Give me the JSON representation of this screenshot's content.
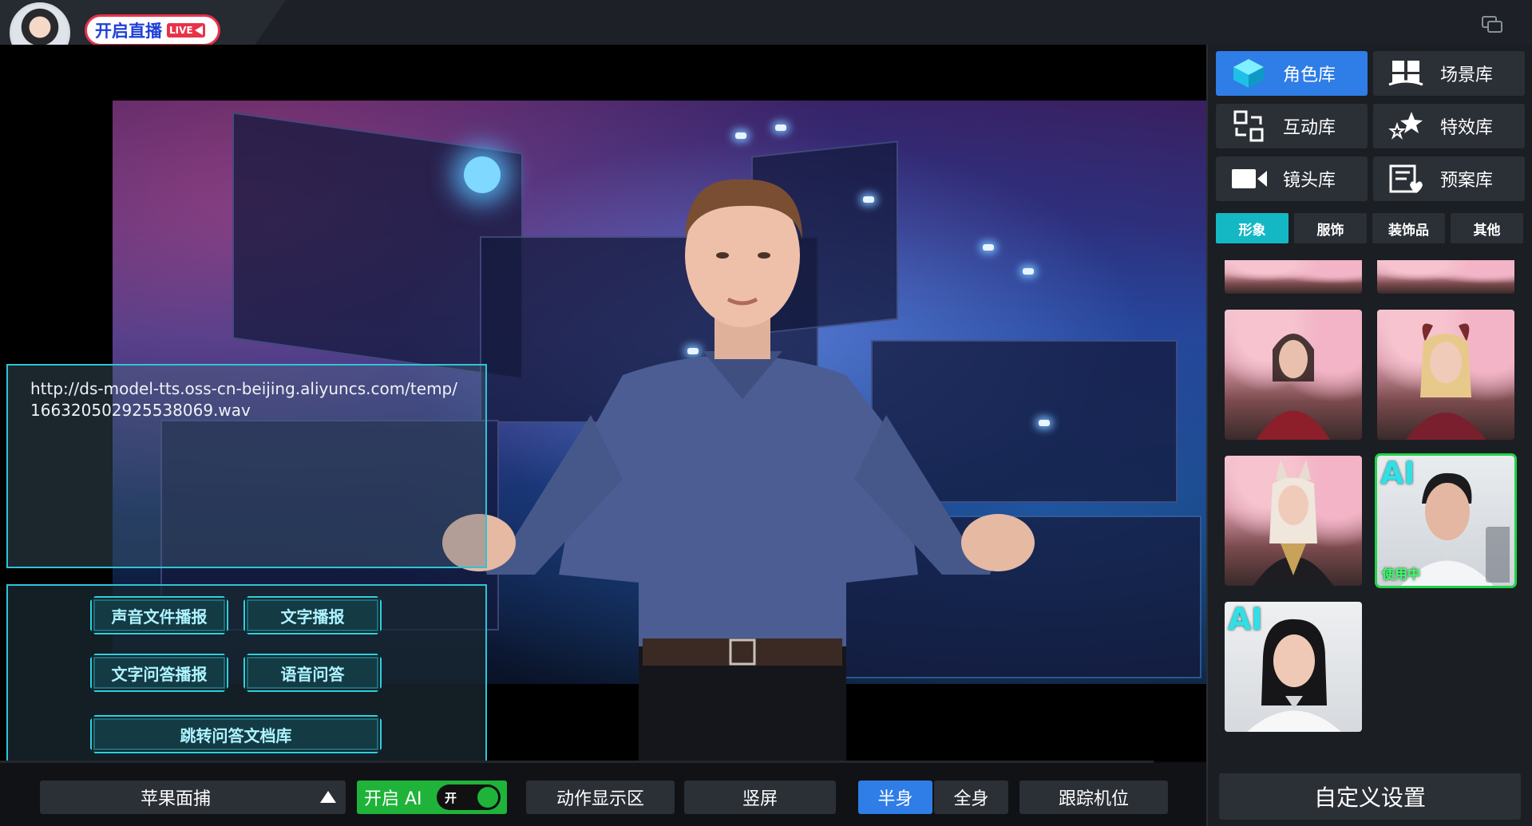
{
  "header": {
    "live_button": "开启直播",
    "live_badge": "LIVE",
    "progress_segments": 6,
    "progress_active": 1
  },
  "stage": {
    "audio_url": "http://ds-model-tts.oss-cn-beijing.aliyuncs.com/temp/16632050292553806​9.wav"
  },
  "actions": {
    "audio_file_broadcast": "声音文件播报",
    "text_broadcast": "文字播报",
    "text_qa_broadcast": "文字问答播报",
    "voice_qa": "语音问答",
    "goto_qa_library": "跳转问答文档库"
  },
  "bottombar": {
    "face_capture": "苹果面捕",
    "ai_toggle_label": "开启 AI",
    "ai_toggle_state": "开",
    "action_display": "动作显示区",
    "portrait": "竖屏",
    "half_body": "半身",
    "full_body": "全身",
    "tracking": "跟踪机位"
  },
  "sidebar": {
    "libraries": [
      {
        "label": "角色库",
        "icon": "cube-icon",
        "active": true
      },
      {
        "label": "场景库",
        "icon": "scene-grid-icon",
        "active": false
      },
      {
        "label": "互动库",
        "icon": "interaction-icon",
        "active": false
      },
      {
        "label": "特效库",
        "icon": "stars-effect-icon",
        "active": false
      },
      {
        "label": "镜头库",
        "icon": "camera-icon",
        "active": false
      },
      {
        "label": "预案库",
        "icon": "plan-list-icon",
        "active": false
      }
    ],
    "subtabs": [
      "形象",
      "服饰",
      "装饰品",
      "其他"
    ],
    "active_subtab": "形象",
    "ai_tag": "AI",
    "in_use_tag": "使用中",
    "custom_settings": "自定义设置"
  },
  "colors": {
    "accent_blue": "#2f7de6",
    "accent_cyan": "#2ec4d6",
    "toggle_green": "#1fb33a",
    "live_red": "#e8324a"
  }
}
